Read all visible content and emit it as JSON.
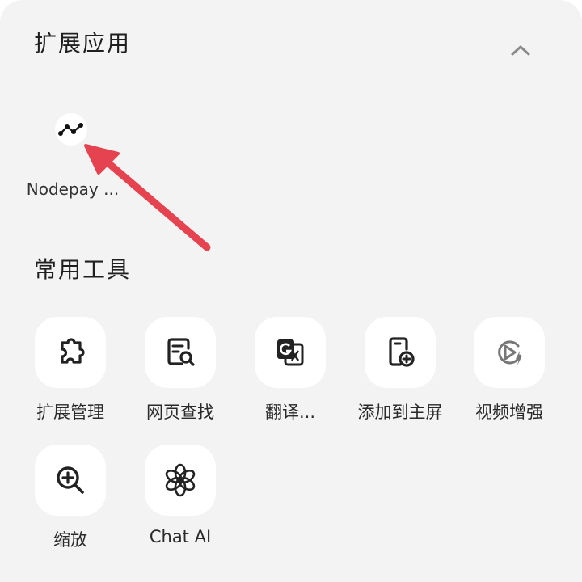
{
  "extensions": {
    "title": "扩展应用",
    "items": [
      {
        "label": "Nodepay ...",
        "icon": "nodepay-icon"
      }
    ]
  },
  "tools": {
    "title": "常用工具",
    "items": [
      {
        "label": "扩展管理",
        "icon": "puzzle-icon"
      },
      {
        "label": "网页查找",
        "icon": "page-search-icon"
      },
      {
        "label": "翻译...",
        "icon": "translate-icon"
      },
      {
        "label": "添加到主屏",
        "icon": "add-to-home-icon"
      },
      {
        "label": "视频增强",
        "icon": "video-boost-icon"
      },
      {
        "label": "缩放",
        "icon": "zoom-icon"
      },
      {
        "label": "Chat AI",
        "icon": "chat-ai-icon"
      }
    ]
  },
  "colors": {
    "background": "#f3f3f3",
    "tile": "#ffffff",
    "annotation_arrow": "#e5434f"
  }
}
